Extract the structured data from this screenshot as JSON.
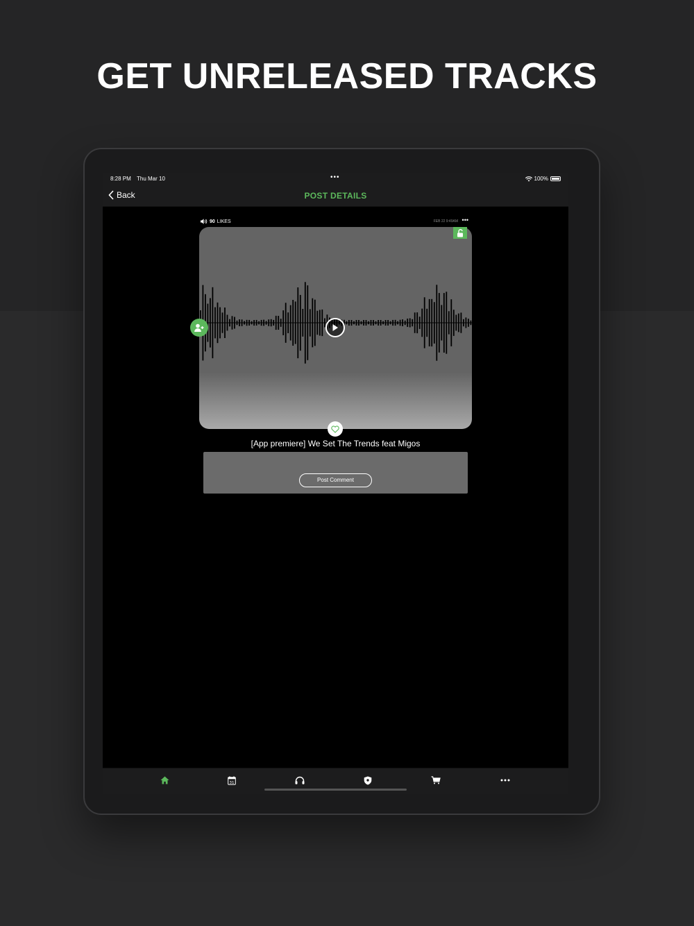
{
  "headline": "GET UNRELEASED TRACKS",
  "status_bar": {
    "time": "8:28 PM",
    "date": "Thu Mar 10",
    "battery": "100%"
  },
  "nav": {
    "back_label": "Back",
    "title": "POST DETAILS"
  },
  "post": {
    "likes_count": "90",
    "likes_label": "LIKES",
    "date": "FEB 22 9:49AM",
    "title": "[App premiere] We Set The Trends feat Migos",
    "comment_button": "Post Comment"
  },
  "tabs": [
    {
      "name": "home-icon",
      "active": true
    },
    {
      "name": "calendar-icon",
      "label": "31"
    },
    {
      "name": "headphones-icon"
    },
    {
      "name": "shield-icon"
    },
    {
      "name": "cart-icon"
    },
    {
      "name": "more-icon"
    }
  ],
  "colors": {
    "accent": "#5cb85c",
    "background": "#2a2a2b",
    "screen": "#000000",
    "card": "#646464"
  }
}
